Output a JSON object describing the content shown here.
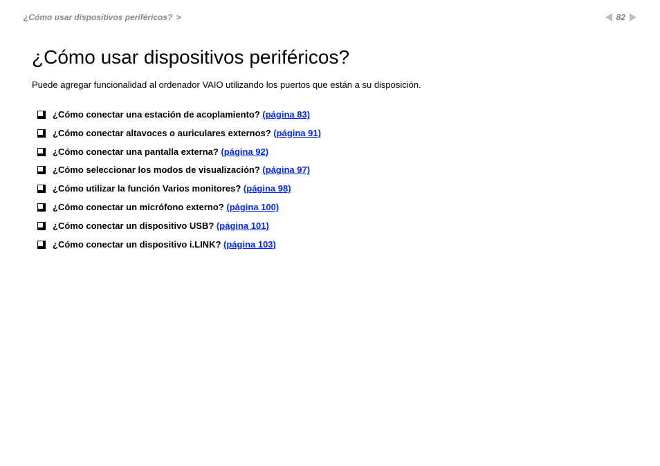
{
  "header": {
    "breadcrumb_label": "¿Cómo usar dispositivos periféricos?",
    "breadcrumb_sep": ">",
    "page_number": "82"
  },
  "title": "¿Cómo usar dispositivos periféricos?",
  "intro": "Puede agregar funcionalidad al ordenador VAIO utilizando los puertos que están a su disposición.",
  "items": [
    {
      "question": "¿Cómo conectar una estación de acoplamiento? ",
      "link": "(página 83)"
    },
    {
      "question": "¿Cómo conectar altavoces o auriculares externos? ",
      "link": "(página 91)"
    },
    {
      "question": "¿Cómo conectar una pantalla externa? ",
      "link": "(página 92)"
    },
    {
      "question": "¿Cómo seleccionar los modos de visualización? ",
      "link": "(página 97)"
    },
    {
      "question": "¿Cómo utilizar la función Varios monitores? ",
      "link": "(página 98)"
    },
    {
      "question": "¿Cómo conectar un micrófono externo? ",
      "link": "(página 100)"
    },
    {
      "question": "¿Cómo conectar un dispositivo USB? ",
      "link": "(página 101)"
    },
    {
      "question": "¿Cómo conectar un dispositivo i.LINK? ",
      "link": "(página 103)"
    }
  ]
}
